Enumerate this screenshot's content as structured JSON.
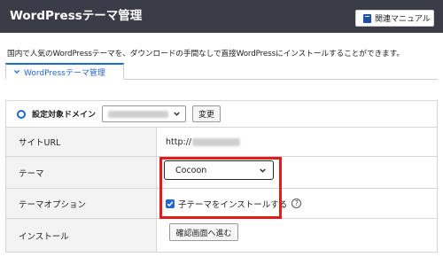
{
  "header": {
    "title": "WordPressテーマ管理",
    "manual_button": "関連マニュアル"
  },
  "description": "国内で人気のWordPressテーマを、ダウンロードの手間なしで直接WordPressにインストールすることができます。",
  "tab": {
    "label": "WordPressテーマ管理"
  },
  "form": {
    "domain_label": "設定対象ドメイン",
    "change_button": "変更",
    "site_url_label": "サイトURL",
    "site_url_prefix": "http://",
    "theme_label": "テーマ",
    "theme_value": "Cocoon",
    "theme_option_label": "テーマオプション",
    "child_theme_checkbox": "子テーマをインストールする",
    "child_theme_checked": true,
    "install_label": "インストール",
    "confirm_button": "確認画面へ進む"
  },
  "colors": {
    "header_bg": "#3a3d47",
    "accent": "#2367d3",
    "highlight": "#e41b1b"
  },
  "icons": {
    "manual": "book-icon",
    "tab": "chevron-down-icon",
    "help": "help-icon",
    "select": "chevron-down-icon"
  }
}
